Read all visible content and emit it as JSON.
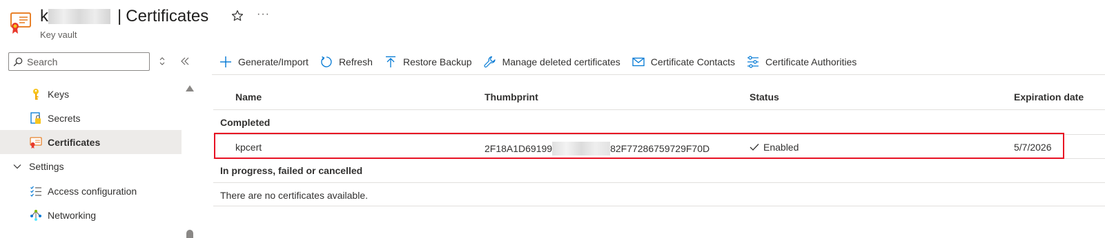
{
  "header": {
    "vault_name_prefix": "k",
    "separator": "|",
    "page_title": "Certificates",
    "subtitle": "Key vault",
    "more_label": "···"
  },
  "sidebar": {
    "search_placeholder": "Search",
    "items": [
      {
        "label": "Keys",
        "icon": "key-icon"
      },
      {
        "label": "Secrets",
        "icon": "secret-icon"
      },
      {
        "label": "Certificates",
        "icon": "certificate-icon",
        "selected": true
      }
    ],
    "settings_group": {
      "label": "Settings",
      "items": [
        {
          "label": "Access configuration",
          "icon": "access-config-icon"
        },
        {
          "label": "Networking",
          "icon": "networking-icon"
        }
      ]
    }
  },
  "toolbar": {
    "generate_import": "Generate/Import",
    "refresh": "Refresh",
    "restore_backup": "Restore Backup",
    "manage_deleted": "Manage deleted certificates",
    "contacts": "Certificate Contacts",
    "authorities": "Certificate Authorities"
  },
  "grid": {
    "columns": [
      "Name",
      "Thumbprint",
      "Status",
      "Expiration date"
    ],
    "groups": {
      "completed": "Completed",
      "in_progress": "In progress, failed or cancelled"
    },
    "rows": [
      {
        "name": "kpcert",
        "thumbprint_start": "2F18A1D69199",
        "thumbprint_end": "82F77286759729F70D",
        "status": "Enabled",
        "expiration": "5/7/2026"
      }
    ],
    "empty_message": "There are no certificates available."
  },
  "colors": {
    "accent": "#0078d4",
    "highlight_border": "#e81123",
    "selected_bg": "#edebe9",
    "divider": "#e1dfdd"
  }
}
